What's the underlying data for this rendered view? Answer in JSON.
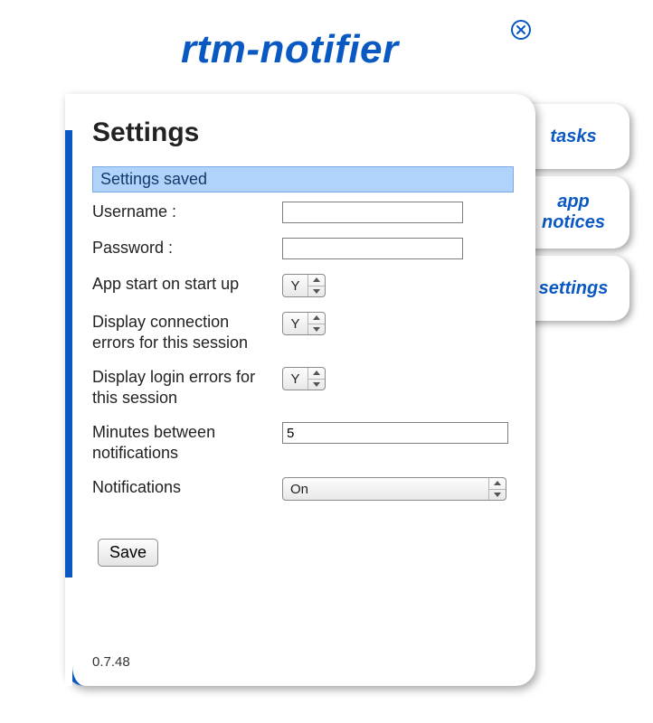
{
  "app": {
    "title": "rtm-notifier",
    "version": "0.7.48"
  },
  "tabs": {
    "tasks": "tasks",
    "app_notices": "app notices",
    "settings": "settings"
  },
  "page": {
    "heading": "Settings",
    "status": "Settings saved",
    "save_button": "Save"
  },
  "form": {
    "username_label": "Username :",
    "username_value": "",
    "password_label": "Password :",
    "password_value": "",
    "start_on_startup_label": "App start on start up",
    "start_on_startup_value": "Y",
    "display_conn_errors_label": "Display connection errors for this session",
    "display_conn_errors_value": "Y",
    "display_login_errors_label": "Display login errors for this session",
    "display_login_errors_value": "Y",
    "minutes_label": "Minutes between notifications",
    "minutes_value": "5",
    "notifications_label": "Notifications",
    "notifications_value": "On"
  }
}
